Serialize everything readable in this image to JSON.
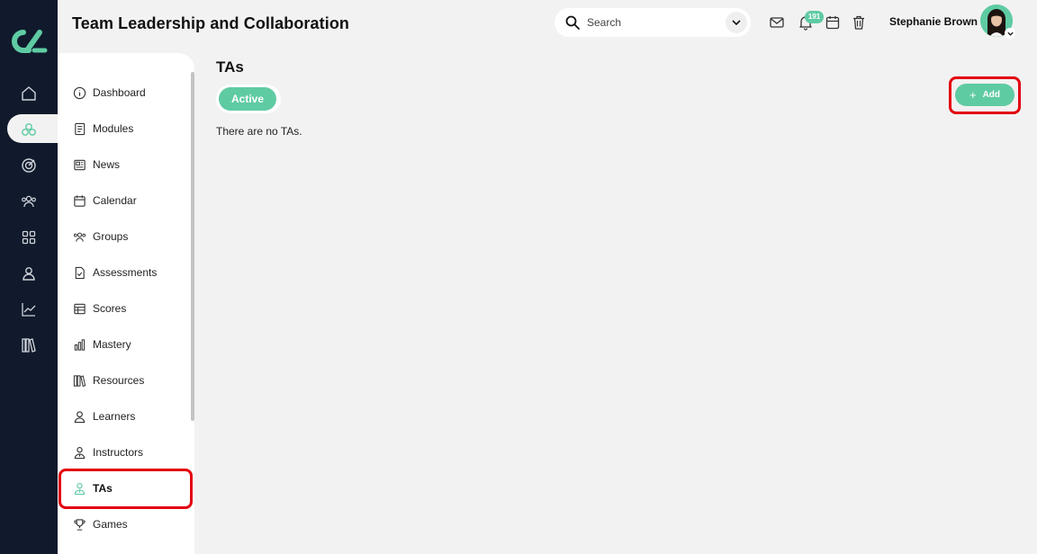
{
  "app": {
    "title": "Team Leadership and Collaboration",
    "accent_color": "#5fcba3",
    "rail_color": "#101a2c"
  },
  "rail": {
    "logo": "brand-logo",
    "icons": [
      "home-icon",
      "modules-hub-icon",
      "target-icon",
      "people-icon",
      "grid-icon",
      "user-icon",
      "chart-icon",
      "library-icon"
    ],
    "active_index": 1
  },
  "header": {
    "search": {
      "placeholder": "Search"
    },
    "icons": [
      "mail-icon",
      "bell-icon",
      "calendar-icon",
      "trash-icon"
    ],
    "notifications_count": "191",
    "user_name": "Stephanie Brown"
  },
  "sidebar": {
    "items": [
      {
        "label": "Dashboard",
        "icon": "info-circle-icon"
      },
      {
        "label": "Modules",
        "icon": "book-icon"
      },
      {
        "label": "News",
        "icon": "newspaper-icon"
      },
      {
        "label": "Calendar",
        "icon": "calendar-icon"
      },
      {
        "label": "Groups",
        "icon": "group-icon"
      },
      {
        "label": "Assessments",
        "icon": "checklist-icon"
      },
      {
        "label": "Scores",
        "icon": "table-icon"
      },
      {
        "label": "Mastery",
        "icon": "bar-chart-icon"
      },
      {
        "label": "Resources",
        "icon": "library-icon"
      },
      {
        "label": "Learners",
        "icon": "user-icon"
      },
      {
        "label": "Instructors",
        "icon": "instructor-icon"
      },
      {
        "label": "TAs",
        "icon": "ta-icon"
      },
      {
        "label": "Games",
        "icon": "trophy-icon"
      }
    ],
    "active_label": "TAs"
  },
  "main": {
    "page_title": "TAs",
    "tabs": [
      {
        "label": "Active",
        "selected": true
      }
    ],
    "add_label": "Add",
    "empty_message": "There are no TAs."
  }
}
